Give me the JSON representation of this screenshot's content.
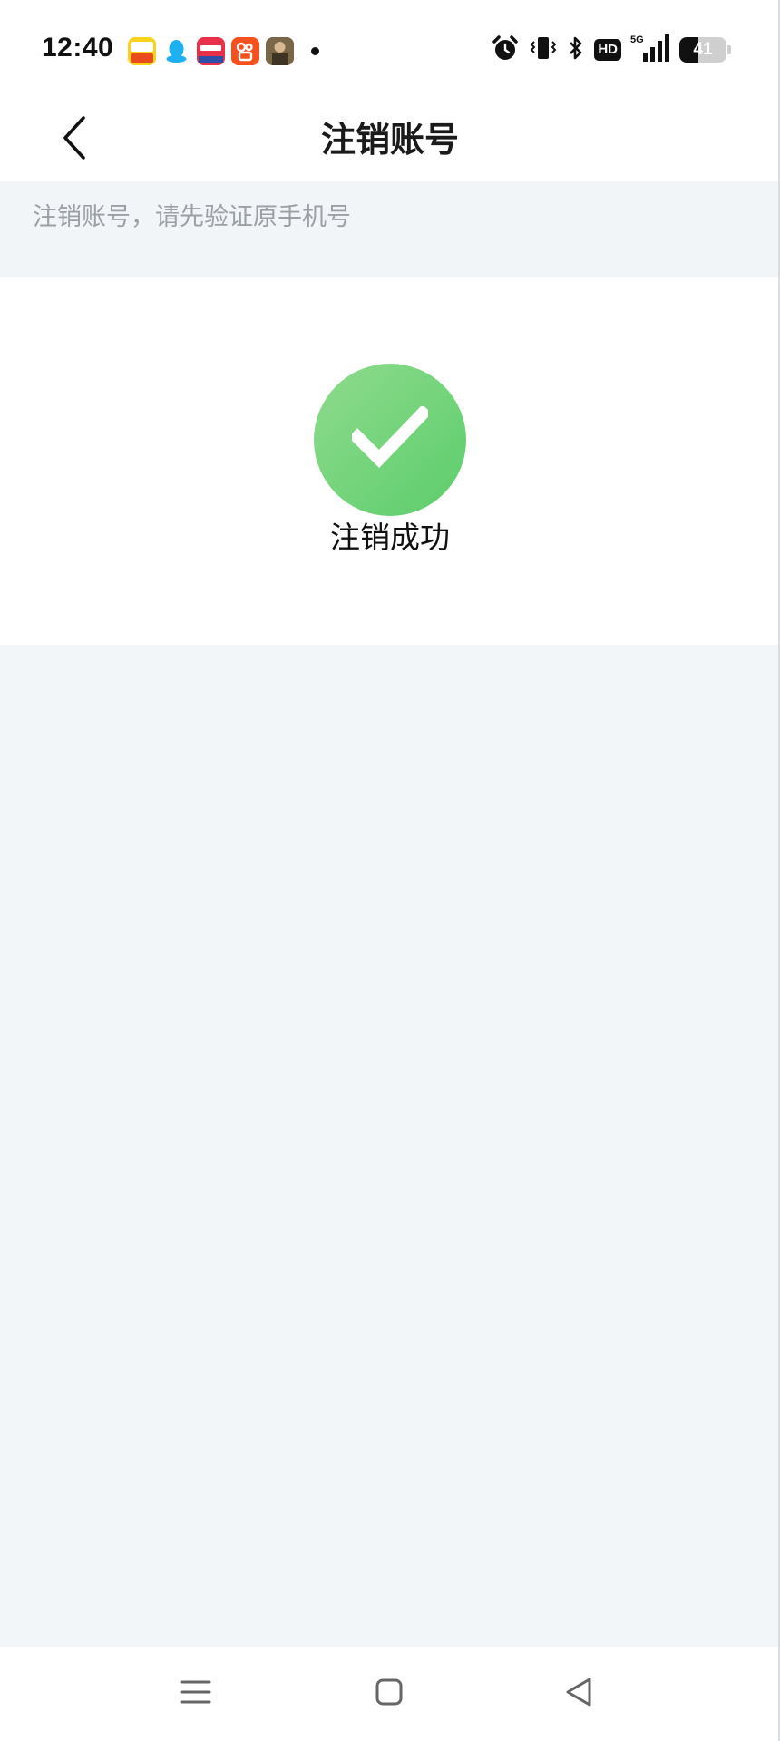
{
  "status_bar": {
    "time": "12:40",
    "notification_apps": [
      "game-app-icon",
      "qq-icon",
      "xiaohongshu-icon",
      "kuaishou-icon",
      "pubg-icon"
    ],
    "network": "5G",
    "hd_label": "HD",
    "battery_level": "41",
    "battery_fraction": 0.41
  },
  "nav": {
    "title": "注销账号"
  },
  "hint": {
    "text": "注销账号，请先验证原手机号"
  },
  "result": {
    "message": "注销成功",
    "accent_color": "#6bd27a"
  },
  "colors": {
    "page_background": "#f3f6f9",
    "hint_text": "#9aa0a6"
  }
}
